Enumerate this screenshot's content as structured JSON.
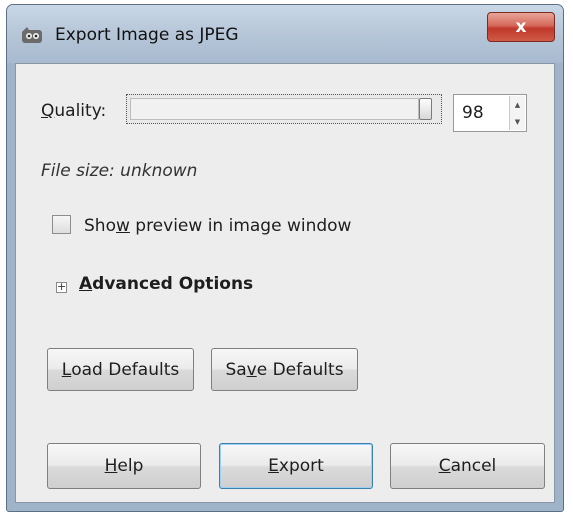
{
  "window": {
    "title": "Export Image as JPEG",
    "close_label": "x"
  },
  "quality": {
    "label_underlined": "Q",
    "label_rest": "uality:",
    "value": "98",
    "slider_fraction": 0.98
  },
  "file_size_text": "File size: unknown",
  "preview": {
    "label_before": "Sho",
    "label_underlined": "w",
    "label_after": " preview in image window",
    "checked": false
  },
  "advanced": {
    "expander_glyph": "+",
    "label_underlined": "A",
    "label_rest": "dvanced Options"
  },
  "buttons": {
    "load_underlined": "L",
    "load_rest": "oad Defaults",
    "save_before": "Sa",
    "save_underlined": "v",
    "save_after": "e Defaults",
    "help_underlined": "H",
    "help_rest": "elp",
    "export_underlined": "E",
    "export_rest": "xport",
    "cancel_underlined": "C",
    "cancel_rest": "ancel"
  },
  "colors": {
    "close_button": "#c0392b",
    "default_button_border": "#3c7fb1",
    "dialog_background": "#ededed"
  },
  "icons": {
    "app": "gimp-wilber-icon"
  }
}
